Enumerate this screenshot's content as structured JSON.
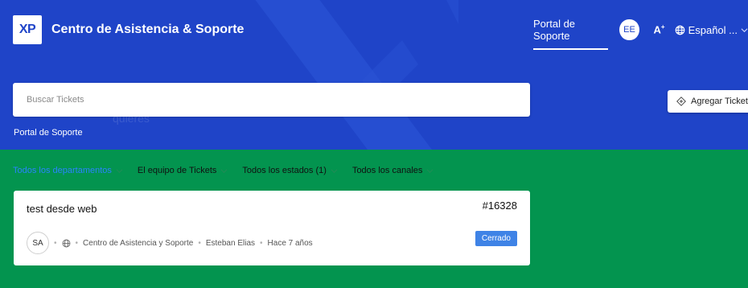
{
  "header": {
    "logo_text": "XP",
    "brand_title": "Centro de Asistencia & Soporte",
    "nav_portal": "Portal de Soporte",
    "user_initials": "EE",
    "font_size_label": "A",
    "font_size_sup": "+",
    "language": "Español ...",
    "accent_color": "#1f44c8"
  },
  "search": {
    "placeholder": "Buscar Tickets",
    "value": ""
  },
  "ghost_text": "quieres",
  "breadcrumb": "Portal de Soporte",
  "add_ticket_label": "Agregar Ticket",
  "filters": [
    {
      "label": "Todos los departamentos",
      "active": true
    },
    {
      "label": "El equipo de Tickets",
      "active": false
    },
    {
      "label": "Todos los estados (1)",
      "active": false
    },
    {
      "label": "Todos los canales",
      "active": false
    }
  ],
  "ticket": {
    "title": "test desde web",
    "number": "#16328",
    "avatar_initials": "SA",
    "department": "Centro de Asistencia y Soporte",
    "assignee": "Esteban Elias",
    "time": "Hace 7 años",
    "status": "Cerrado",
    "status_color": "#3f83e6"
  },
  "body_color": "#03944f"
}
